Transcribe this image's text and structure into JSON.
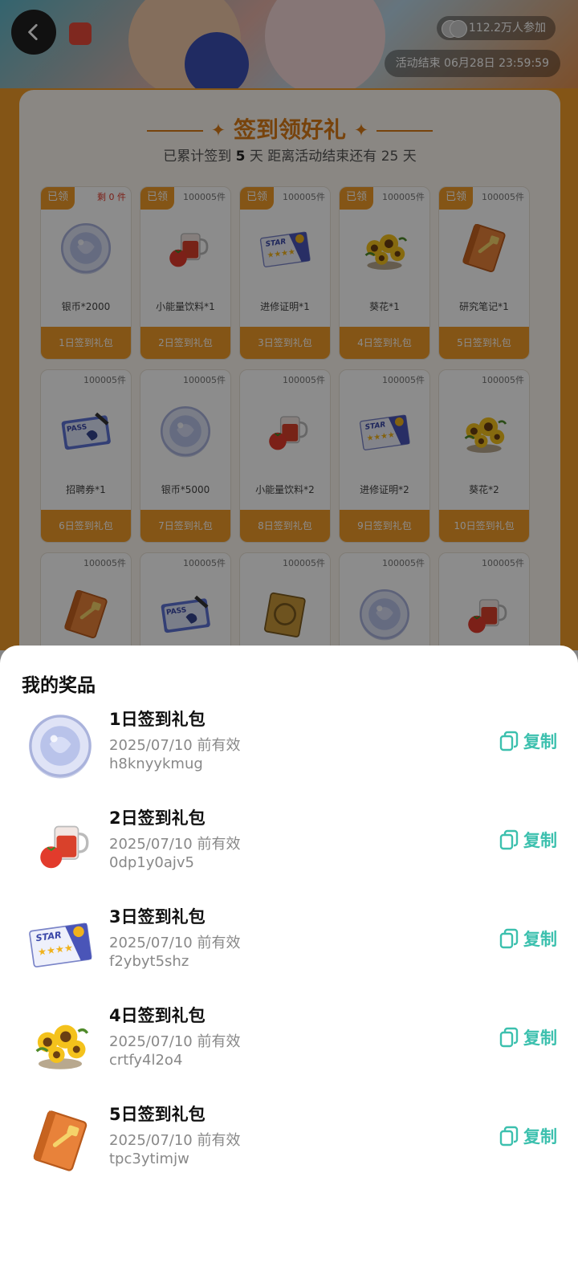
{
  "header": {
    "participants": "112.2万人参加",
    "end_time": "活动结束 06月28日 23:59:59"
  },
  "checkin": {
    "title": "签到领好礼",
    "summary_prefix": "已累计签到",
    "days_signed": "5",
    "summary_mid": "天   距离活动结束还有",
    "days_left": "25",
    "summary_suffix": "天",
    "items": [
      {
        "stock": "剩 0 件",
        "badge": "已领",
        "name": "银币*2000",
        "foot": "1日签到礼包",
        "icon": "silver-coin"
      },
      {
        "stock": "100005件",
        "badge": "已领",
        "name": "小能量饮料*1",
        "foot": "2日签到礼包",
        "icon": "energy-drink"
      },
      {
        "stock": "100005件",
        "badge": "已领",
        "name": "进修证明*1",
        "foot": "3日签到礼包",
        "icon": "star-certificate"
      },
      {
        "stock": "100005件",
        "badge": "已领",
        "name": "葵花*1",
        "foot": "4日签到礼包",
        "icon": "sunflower"
      },
      {
        "stock": "100005件",
        "badge": "已领",
        "name": "研究笔记*1",
        "foot": "5日签到礼包",
        "icon": "research-notebook"
      },
      {
        "stock": "100005件",
        "badge": "",
        "name": "招聘券*1",
        "foot": "6日签到礼包",
        "icon": "pass-ticket"
      },
      {
        "stock": "100005件",
        "badge": "",
        "name": "银币*5000",
        "foot": "7日签到礼包",
        "icon": "silver-coin"
      },
      {
        "stock": "100005件",
        "badge": "",
        "name": "小能量饮料*2",
        "foot": "8日签到礼包",
        "icon": "energy-drink"
      },
      {
        "stock": "100005件",
        "badge": "",
        "name": "进修证明*2",
        "foot": "9日签到礼包",
        "icon": "star-certificate"
      },
      {
        "stock": "100005件",
        "badge": "",
        "name": "葵花*2",
        "foot": "10日签到礼包",
        "icon": "sunflower"
      },
      {
        "stock": "100005件",
        "badge": "",
        "name": "",
        "foot": "",
        "icon": "research-notebook"
      },
      {
        "stock": "100005件",
        "badge": "",
        "name": "",
        "foot": "",
        "icon": "pass-ticket"
      },
      {
        "stock": "100005件",
        "badge": "",
        "name": "",
        "foot": "",
        "icon": "gold-pack"
      },
      {
        "stock": "100005件",
        "badge": "",
        "name": "",
        "foot": "",
        "icon": "silver-coin"
      },
      {
        "stock": "100005件",
        "badge": "",
        "name": "",
        "foot": "",
        "icon": "energy-drink"
      }
    ]
  },
  "sheet": {
    "title": "我的奖品",
    "copy_label": "复制",
    "prizes": [
      {
        "name": "1日签到礼包",
        "valid": "2025/07/10 前有效",
        "code": "h8knyykmug",
        "icon": "silver-coin"
      },
      {
        "name": "2日签到礼包",
        "valid": "2025/07/10 前有效",
        "code": "0dp1y0ajv5",
        "icon": "energy-drink"
      },
      {
        "name": "3日签到礼包",
        "valid": "2025/07/10 前有效",
        "code": "f2ybyt5shz",
        "icon": "star-certificate"
      },
      {
        "name": "4日签到礼包",
        "valid": "2025/07/10 前有效",
        "code": "crtfy4l2o4",
        "icon": "sunflower"
      },
      {
        "name": "5日签到礼包",
        "valid": "2025/07/10 前有效",
        "code": "tpc3ytimjw",
        "icon": "research-notebook"
      }
    ]
  },
  "colors": {
    "accent": "#f19b28",
    "copy": "#3cc0ae",
    "stock_red": "#e23b2c"
  }
}
